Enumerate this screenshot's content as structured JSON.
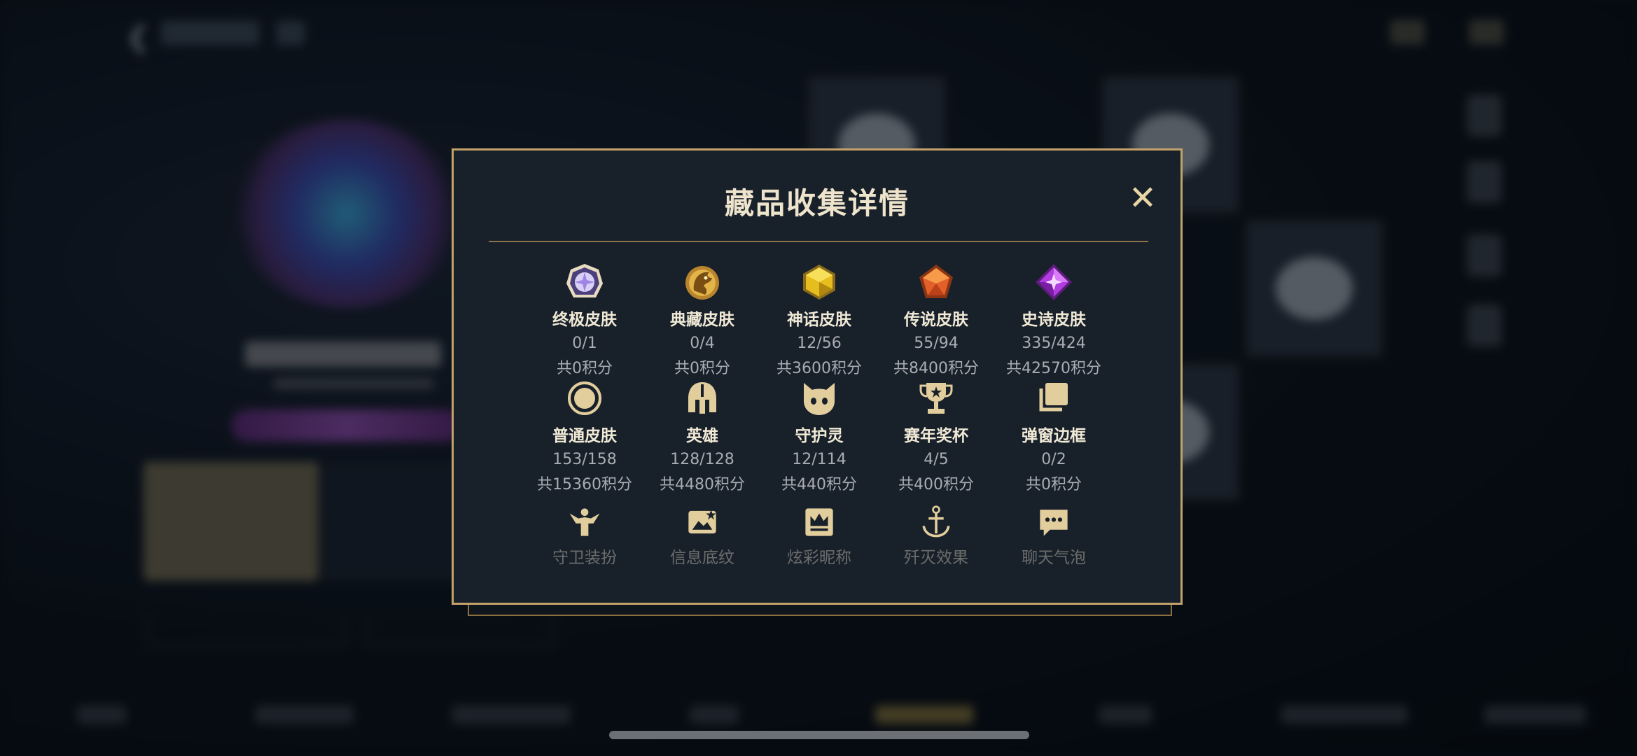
{
  "dialog": {
    "title": "藏品收集详情"
  },
  "collection_rows": [
    [
      {
        "name": "终极皮肤",
        "count": "0/1",
        "points": "共0积分",
        "icon": "ultimate-skin-gem-icon"
      },
      {
        "name": "典藏皮肤",
        "count": "0/4",
        "points": "共0积分",
        "icon": "collection-skin-dragon-icon"
      },
      {
        "name": "神话皮肤",
        "count": "12/56",
        "points": "共3600积分",
        "icon": "mythic-skin-gem-icon"
      },
      {
        "name": "传说皮肤",
        "count": "55/94",
        "points": "共8400积分",
        "icon": "legendary-skin-gem-icon"
      },
      {
        "name": "史诗皮肤",
        "count": "335/424",
        "points": "共42570积分",
        "icon": "epic-skin-gem-icon"
      }
    ],
    [
      {
        "name": "普通皮肤",
        "count": "153/158",
        "points": "共15360积分",
        "icon": "normal-skin-circle-icon"
      },
      {
        "name": "英雄",
        "count": "128/128",
        "points": "共4480积分",
        "icon": "hero-helmet-icon"
      },
      {
        "name": "守护灵",
        "count": "12/114",
        "points": "共440积分",
        "icon": "guardian-spirit-icon"
      },
      {
        "name": "赛年奖杯",
        "count": "4/5",
        "points": "共400积分",
        "icon": "season-trophy-icon"
      },
      {
        "name": "弹窗边框",
        "count": "0/2",
        "points": "共0积分",
        "icon": "popup-frame-icon"
      }
    ],
    [
      {
        "name": "守卫装扮",
        "icon": "guard-outfit-icon"
      },
      {
        "name": "信息底纹",
        "icon": "info-background-icon"
      },
      {
        "name": "炫彩昵称",
        "icon": "colorful-nickname-icon"
      },
      {
        "name": "歼灭效果",
        "icon": "kill-effect-icon"
      },
      {
        "name": "聊天气泡",
        "icon": "chat-bubble-icon"
      }
    ]
  ],
  "colors": {
    "gold_border": "#c3a26a",
    "dialog_bg": "#18202a",
    "title_text": "#eee4cc",
    "icon_gold": "#e2cd9d"
  }
}
